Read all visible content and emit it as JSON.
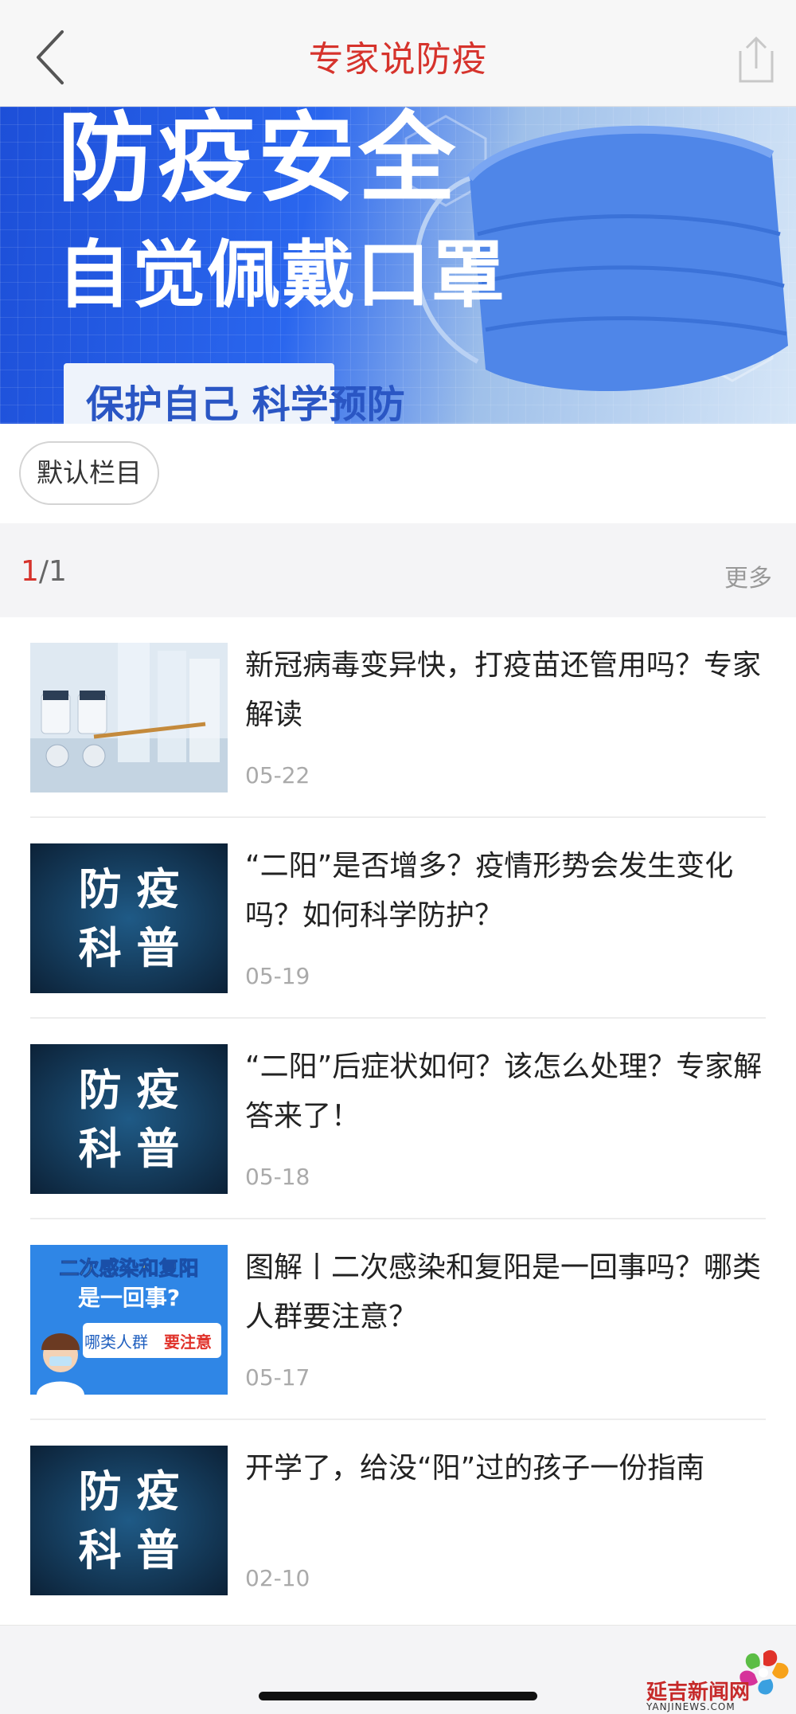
{
  "header": {
    "title": "专家说防疫",
    "back_icon": "chevron-left-icon",
    "share_icon": "share-icon"
  },
  "banner": {
    "headline": "防疫安全",
    "subheadline": "自觉佩戴口罩",
    "tagline": "保护自己 科学预防",
    "colors": {
      "primary": "#1d4fd8",
      "light": "#d6e6f7"
    }
  },
  "category": {
    "label": "默认栏目"
  },
  "pager": {
    "current": "1",
    "total": "/1",
    "more_label": "更多"
  },
  "thumb_text": {
    "a1": "防  疫",
    "a2": "科  普",
    "b1": "二次感染和复阳",
    "b2": "是一回事?",
    "b3": "哪类人群",
    "b4": "要注意"
  },
  "articles": [
    {
      "title": "新冠病毒变异快，打疫苗还管用吗？专家解读",
      "date": "05-22",
      "thumb": "vaccine-vials"
    },
    {
      "title": "“二阳”是否增多？疫情形势会发生变化吗？如何科学防护？",
      "date": "05-19",
      "thumb": "防疫科普"
    },
    {
      "title": "“二阳”后症状如何？该怎么处理？专家解答来了！",
      "date": "05-18",
      "thumb": "防疫科普"
    },
    {
      "title": "图解丨二次感染和复阳是一回事吗？哪类人群要注意？",
      "date": "05-17",
      "thumb": "infographic"
    },
    {
      "title": "开学了，给没“阳”过的孩子一份指南",
      "date": "02-10",
      "thumb": "防疫科普"
    }
  ],
  "watermark": {
    "name": "延吉新闻网",
    "url": "YANJINEWS.COM"
  },
  "colors": {
    "accent": "#d6332c",
    "divider": "#ededed",
    "date": "#aaaaaa"
  }
}
